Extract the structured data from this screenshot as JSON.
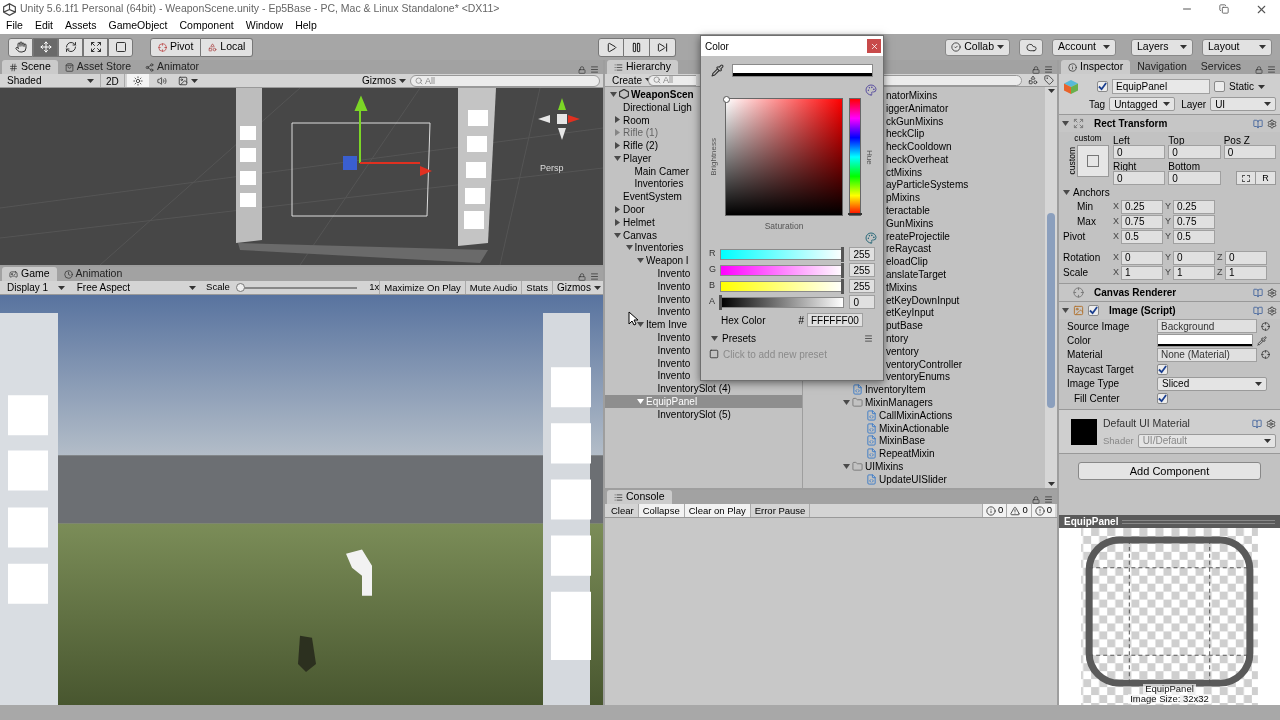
{
  "window": {
    "title": "Unity 5.6.1f1 Personal (64bit) - WeaponScene.unity - Ep5Base - PC, Mac & Linux Standalone* <DX11>"
  },
  "menu": [
    "File",
    "Edit",
    "Assets",
    "GameObject",
    "Component",
    "Window",
    "Help"
  ],
  "toolbar": {
    "tools": [
      {
        "kind": "hand",
        "selected": false
      },
      {
        "kind": "move",
        "selected": true
      },
      {
        "kind": "rotate",
        "selected": false
      },
      {
        "kind": "scale",
        "selected": false
      },
      {
        "kind": "rect",
        "selected": false
      }
    ],
    "pivot": "Pivot",
    "space": "Local",
    "collab": "Collab",
    "account": "Account",
    "layers": "Layers",
    "layout": "Layout"
  },
  "scene_panel": {
    "tabs": [
      {
        "label": "Scene",
        "kind": "scene",
        "selected": true
      },
      {
        "label": "Asset Store",
        "kind": "store",
        "selected": false
      },
      {
        "label": "Animator",
        "kind": "animator",
        "selected": false
      }
    ],
    "shading": "Shaded",
    "mode_2d": "2D",
    "lighting_on": true,
    "audio_on": false,
    "gizmos": "Gizmos",
    "search": {
      "placeholder": "All"
    },
    "view_label": "Persp"
  },
  "game_panel": {
    "tabs": [
      {
        "label": "Game",
        "kind": "game",
        "selected": true
      },
      {
        "label": "Animation",
        "kind": "animation",
        "selected": false
      }
    ],
    "display": "Display 1",
    "aspect": "Free Aspect",
    "scale_label": "Scale",
    "scale": {
      "level": 0
    },
    "scale_reading": "1x",
    "toggles": [
      "Maximize On Play",
      "Mute Audio",
      "Stats"
    ],
    "gizmos": "Gizmos"
  },
  "hierarchy": {
    "tab": "Hierarchy",
    "create": "Create",
    "search": {
      "placeholder": "All"
    },
    "tree": [
      {
        "name": "WeaponScen",
        "kind": "scene",
        "selected": false,
        "inactive": false,
        "expanded": true,
        "children": [
          {
            "name": "Directional Ligh",
            "selected": false,
            "inactive": false
          },
          {
            "name": "Room",
            "selected": false,
            "inactive": false,
            "expanded": false
          },
          {
            "name": "Rifle (1)",
            "selected": false,
            "inactive": true,
            "expanded": false
          },
          {
            "name": "Rifle (2)",
            "selected": false,
            "inactive": false,
            "expanded": false
          },
          {
            "name": "Player",
            "selected": false,
            "inactive": false,
            "expanded": true,
            "children": [
              {
                "name": "Main Camer",
                "selected": false,
                "inactive": false
              },
              {
                "name": "Inventories",
                "selected": false,
                "inactive": false
              }
            ]
          },
          {
            "name": "EventSystem",
            "selected": false,
            "inactive": false
          },
          {
            "name": "Door",
            "selected": false,
            "inactive": false,
            "expanded": false
          },
          {
            "name": "Helmet",
            "selected": false,
            "inactive": false,
            "expanded": false
          },
          {
            "name": "Canvas",
            "selected": false,
            "inactive": false,
            "expanded": true,
            "children": [
              {
                "name": "Inventories",
                "selected": false,
                "inactive": false,
                "expanded": true,
                "children": [
                  {
                    "name": "Weapon I",
                    "selected": false,
                    "inactive": false,
                    "expanded": true,
                    "children": [
                      {
                        "name": "Invento",
                        "selected": false,
                        "inactive": false
                      },
                      {
                        "name": "Invento",
                        "selected": false,
                        "inactive": false
                      },
                      {
                        "name": "Invento",
                        "selected": false,
                        "inactive": false
                      },
                      {
                        "name": "Invento",
                        "selected": false,
                        "inactive": false
                      }
                    ]
                  },
                  {
                    "name": "Item Inve",
                    "selected": false,
                    "inactive": false,
                    "expanded": true,
                    "children": [
                      {
                        "name": "Invento",
                        "selected": false,
                        "inactive": false
                      },
                      {
                        "name": "Invento",
                        "selected": false,
                        "inactive": false
                      },
                      {
                        "name": "Invento",
                        "selected": false,
                        "inactive": false
                      },
                      {
                        "name": "Invento",
                        "selected": false,
                        "inactive": false
                      },
                      {
                        "name": "InventorySlot (4)",
                        "selected": false,
                        "inactive": false
                      }
                    ]
                  },
                  {
                    "name": "EquipPanel",
                    "selected": true,
                    "inactive": false,
                    "expanded": true,
                    "children": [
                      {
                        "name": "InventorySlot (5)",
                        "selected": false,
                        "inactive": false
                      }
                    ]
                  }
                ]
              }
            ]
          }
        ]
      }
    ]
  },
  "project": {
    "clipped_rows": [
      "natorMixins",
      "iggerAnimator",
      "ckGunMixins",
      "heckClip",
      "heckCooldown",
      "heckOverheat",
      "ctMixins",
      "ayParticleSystems",
      "pMixins",
      "teractable",
      "GunMixins",
      "reateProjectile",
      "reRaycast",
      "eloadClip",
      "anslateTarget",
      "tMixins",
      "etKeyDownInput",
      "etKeyInput",
      "putBase",
      "ntory",
      "ventory",
      "ventoryController",
      "ventoryEnums"
    ],
    "rows": [
      {
        "name": "InventoryItem",
        "kind": "script"
      },
      {
        "name": "MixinManagers",
        "kind": "folder",
        "expanded": true,
        "children": [
          {
            "name": "CallMixinActions",
            "kind": "script"
          },
          {
            "name": "MixinActionable",
            "kind": "script"
          },
          {
            "name": "MixinBase",
            "kind": "script"
          },
          {
            "name": "RepeatMixin",
            "kind": "script"
          }
        ]
      },
      {
        "name": "UIMixins",
        "kind": "folder",
        "expanded": true,
        "children": [
          {
            "name": "UpdateUISlider",
            "kind": "script"
          }
        ]
      }
    ]
  },
  "console": {
    "tab": "Console",
    "buttons": [
      {
        "label": "Clear",
        "on": false
      },
      {
        "label": "Collapse",
        "on": true
      },
      {
        "label": "Clear on Play",
        "on": true
      },
      {
        "label": "Error Pause",
        "on": false
      }
    ],
    "counts": [
      {
        "kind": "info",
        "value": "0"
      },
      {
        "kind": "warning",
        "value": "0"
      },
      {
        "kind": "error",
        "value": "0"
      }
    ]
  },
  "color_picker": {
    "title": "Color",
    "brightness_label": "Brightness",
    "saturation_label": "Saturation",
    "hue_label": "Hue",
    "channels": [
      {
        "label": "R",
        "kind": "rgb",
        "level": 1,
        "reading": "255"
      },
      {
        "label": "G",
        "kind": "rgb",
        "level": 1,
        "reading": "255"
      },
      {
        "label": "B",
        "kind": "rgb",
        "level": 1,
        "reading": "255"
      },
      {
        "label": "A",
        "kind": "alpha",
        "level": 0,
        "reading": "0"
      }
    ],
    "hex_label": "Hex Color",
    "hex_prefix": "#",
    "hex": "FFFFFF00",
    "presets": {
      "label": "Presets",
      "expanded": true,
      "hint": "Click to add new preset"
    }
  },
  "inspector": {
    "tabs": [
      {
        "label": "Inspector",
        "kind": "inspector",
        "selected": true
      },
      {
        "label": "Navigation",
        "kind": "navigation",
        "selected": false
      },
      {
        "label": "Services",
        "kind": "services",
        "selected": false
      }
    ],
    "object": {
      "active": true,
      "name": "EquipPanel",
      "static_label": "Static",
      "static": false,
      "tag_label": "Tag",
      "tag": "Untagged",
      "layer_label": "Layer",
      "layer": "UI"
    },
    "rect_transform": {
      "title": "Rect Transform",
      "expanded": true,
      "preset_top": "custom",
      "preset_side": "custom",
      "fields": [
        {
          "label": "Left",
          "value": "0"
        },
        {
          "label": "Top",
          "value": "0"
        },
        {
          "label": "Pos Z",
          "value": "0"
        },
        {
          "label": "Right",
          "value": "0"
        },
        {
          "label": "Bottom",
          "value": "0"
        }
      ],
      "raw_button": "R",
      "anchors": {
        "label": "Anchors",
        "expanded": true,
        "rows": [
          {
            "label": "Min",
            "values": [
              {
                "axis": "X",
                "value": "0.25"
              },
              {
                "axis": "Y",
                "value": "0.25"
              }
            ]
          },
          {
            "label": "Max",
            "values": [
              {
                "axis": "X",
                "value": "0.75"
              },
              {
                "axis": "Y",
                "value": "0.75"
              }
            ]
          }
        ]
      },
      "rows": [
        {
          "label": "Pivot",
          "values": [
            {
              "axis": "X",
              "value": "0.5"
            },
            {
              "axis": "Y",
              "value": "0.5"
            }
          ]
        },
        {
          "label": "Rotation",
          "values": [
            {
              "axis": "X",
              "value": "0"
            },
            {
              "axis": "Y",
              "value": "0"
            },
            {
              "axis": "Z",
              "value": "0"
            }
          ]
        },
        {
          "label": "Scale",
          "values": [
            {
              "axis": "X",
              "value": "1"
            },
            {
              "axis": "Y",
              "value": "1"
            },
            {
              "axis": "Z",
              "value": "1"
            }
          ]
        }
      ]
    },
    "canvas_renderer": {
      "title": "Canvas Renderer"
    },
    "image": {
      "title": "Image (Script)",
      "enabled": true,
      "expanded": true,
      "props": [
        {
          "label": "Source Image",
          "kind": "object",
          "value": "Background"
        },
        {
          "label": "Color",
          "kind": "color",
          "color": "#ffffff"
        },
        {
          "label": "Material",
          "kind": "object",
          "value": "None (Material)"
        },
        {
          "label": "Raycast Target",
          "kind": "checkbox",
          "checked": true
        },
        {
          "label": "Image Type",
          "kind": "dropdown",
          "value": "Sliced",
          "children": [
            {
              "label": "Fill Center",
              "kind": "checkbox",
              "checked": true
            }
          ]
        }
      ]
    },
    "material": {
      "name": "Default UI Material",
      "shader_label": "Shader",
      "shader": "UI/Default"
    },
    "add_component": "Add Component"
  },
  "preview": {
    "title": "EquipPanel",
    "name": "EquipPanel",
    "size": "Image Size: 32x32"
  }
}
